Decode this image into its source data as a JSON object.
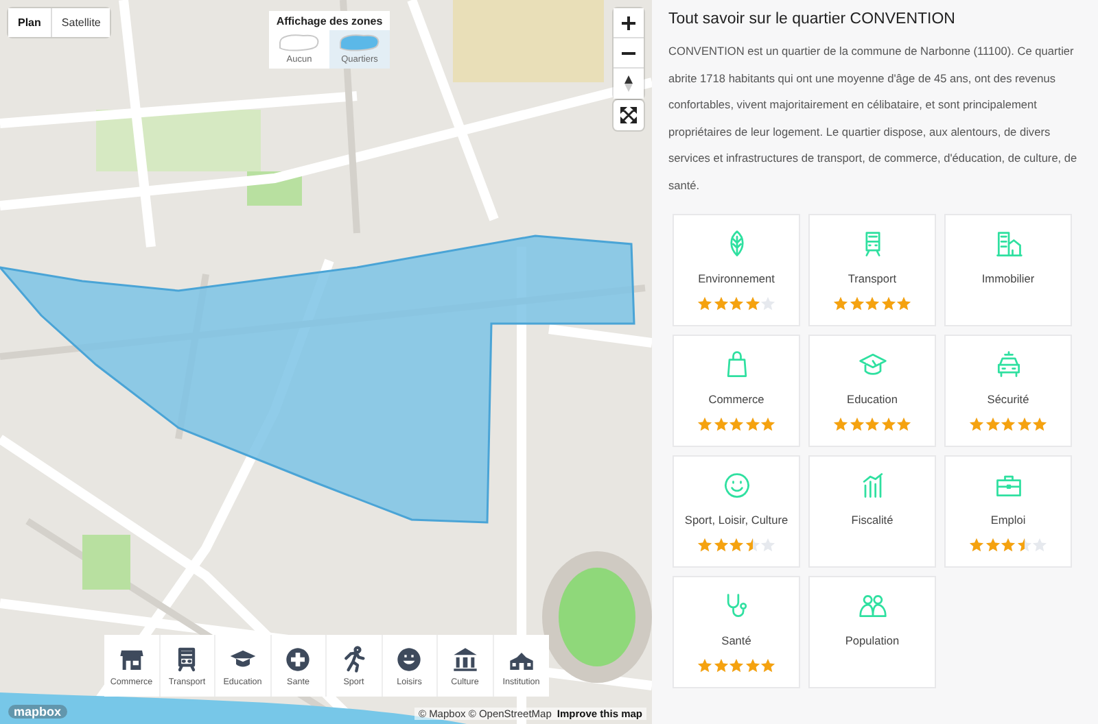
{
  "map": {
    "style_toggle": [
      {
        "label": "Plan",
        "selected": true
      },
      {
        "label": "Satellite",
        "selected": false
      }
    ],
    "zones": {
      "title": "Affichage des zones",
      "options": [
        {
          "label": "Aucun",
          "selected": false
        },
        {
          "label": "Quartiers",
          "selected": true
        }
      ]
    },
    "categories": [
      "Commerce",
      "Transport",
      "Education",
      "Sante",
      "Sport",
      "Loisirs",
      "Culture",
      "Institution"
    ],
    "logo": "mapbox",
    "attribution": "© Mapbox © OpenStreetMap",
    "improve_link": "Improve this map"
  },
  "panel": {
    "title": "Tout savoir sur le quartier CONVENTION",
    "description": "CONVENTION est un quartier de la commune de Narbonne (11100). Ce quartier abrite 1718 habitants qui ont une moyenne d'âge de 45 ans, ont des revenus confortables, vivent majoritairement en célibataire, et sont principalement propriétaires de leur logement. Le quartier dispose, aux alentours, de divers services et infrastructures de transport, de commerce, d'éducation, de culture, de santé.",
    "cards": [
      {
        "label": "Environnement",
        "stars": 4
      },
      {
        "label": "Transport",
        "stars": 5
      },
      {
        "label": "Immobilier"
      },
      {
        "label": "Commerce",
        "stars": 5
      },
      {
        "label": "Education",
        "stars": 5
      },
      {
        "label": "Sécurité",
        "stars": 5
      },
      {
        "label": "Sport, Loisir, Culture",
        "stars": 3.5
      },
      {
        "label": "Fiscalité"
      },
      {
        "label": "Emploi",
        "stars": 3.5
      },
      {
        "label": "Santé",
        "stars": 5
      },
      {
        "label": "Population"
      }
    ]
  }
}
